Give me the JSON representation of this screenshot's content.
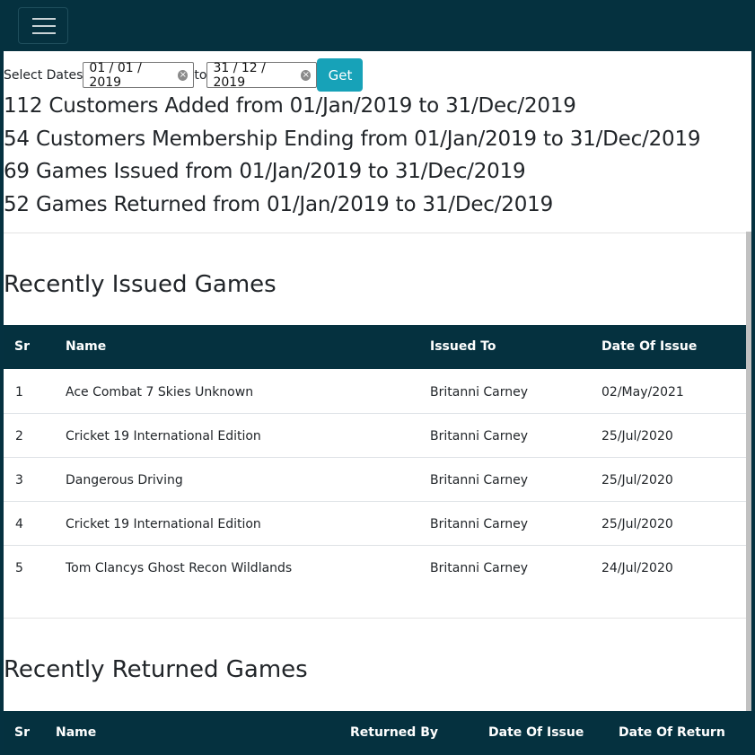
{
  "filter": {
    "label": "Select Dates",
    "from_date": "01 / 01 / 2019",
    "to_label": "to",
    "to_date": "31 / 12 / 2019",
    "get_label": "Get"
  },
  "stats": [
    "112 Customers Added from 01/Jan/2019 to 31/Dec/2019",
    "54 Customers Membership Ending from 01/Jan/2019 to 31/Dec/2019",
    "69 Games Issued from 01/Jan/2019 to 31/Dec/2019",
    "52 Games Returned from 01/Jan/2019 to 31/Dec/2019"
  ],
  "issued": {
    "title": "Recently Issued Games",
    "columns": [
      "Sr",
      "Name",
      "Issued To",
      "Date Of Issue"
    ],
    "rows": [
      [
        "1",
        "Ace Combat 7 Skies Unknown",
        "Britanni Carney",
        "02/May/2021"
      ],
      [
        "2",
        "Cricket 19 International Edition",
        "Britanni Carney",
        "25/Jul/2020"
      ],
      [
        "3",
        "Dangerous Driving",
        "Britanni Carney",
        "25/Jul/2020"
      ],
      [
        "4",
        "Cricket 19 International Edition",
        "Britanni Carney",
        "25/Jul/2020"
      ],
      [
        "5",
        "Tom Clancys Ghost Recon Wildlands",
        "Britanni Carney",
        "24/Jul/2020"
      ]
    ]
  },
  "returned": {
    "title": "Recently Returned Games",
    "columns": [
      "Sr",
      "Name",
      "Returned By",
      "Date Of Issue",
      "Date Of Return"
    ]
  },
  "colors": {
    "navbar": "#05313f",
    "button": "#17a2b8"
  },
  "icons": [
    "menu-icon",
    "clear-icon"
  ]
}
